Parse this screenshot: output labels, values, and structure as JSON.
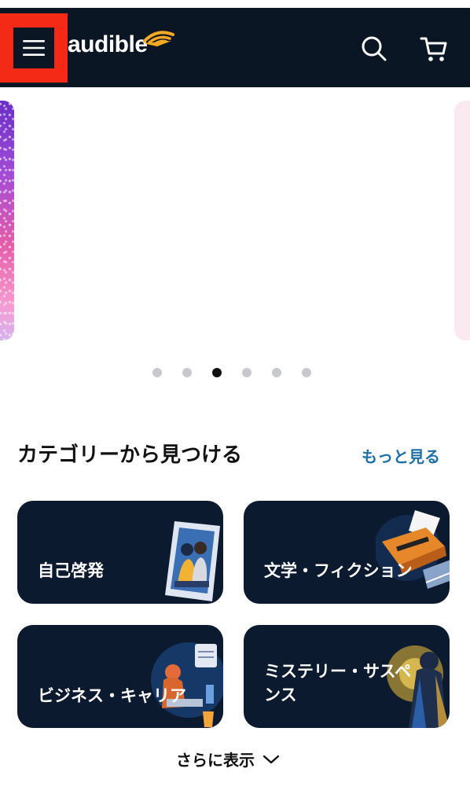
{
  "header": {
    "logo_text": "audible",
    "menu_icon": "hamburger-menu-icon",
    "search_icon": "search-icon",
    "cart_icon": "cart-icon",
    "background": "#0b1624",
    "highlight_color": "#f42a16"
  },
  "carousel": {
    "total_slides": 6,
    "active_index": 2
  },
  "categories": {
    "title": "カテゴリーから見つける",
    "see_more": "もっと見る",
    "tiles": [
      {
        "label": "自己啓発",
        "icon": "photo-frame-illustration"
      },
      {
        "label": "文学・フィクション",
        "icon": "typewriter-illustration"
      },
      {
        "label": "ビジネス・キャリア",
        "icon": "desk-worker-illustration"
      },
      {
        "label": "ミステリー・サスペンス",
        "label_line1": "ミステリー・サスペ",
        "label_line2": "ンス",
        "icon": "detective-illustration"
      }
    ],
    "show_more": "さらに表示",
    "show_more_icon": "chevron-down-icon"
  },
  "colors": {
    "accent_link": "#1f6fa7",
    "tile_background": "#0b1a2e",
    "logo_accent": "#f7a823"
  }
}
